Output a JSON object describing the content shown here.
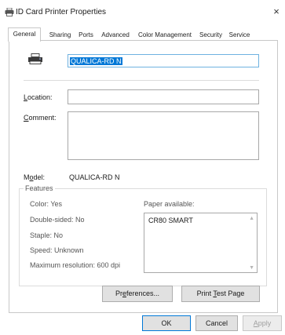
{
  "window": {
    "title": "ID Card Printer Properties",
    "close_glyph": "×",
    "icon": "printer-icon"
  },
  "tabs": [
    {
      "label": "General",
      "active": true
    },
    {
      "label": "Sharing",
      "active": false
    },
    {
      "label": "Ports",
      "active": false
    },
    {
      "label": "Advanced",
      "active": false
    },
    {
      "label": "Color Management",
      "active": false
    },
    {
      "label": "Security",
      "active": false
    },
    {
      "label": "Service",
      "active": false
    }
  ],
  "general": {
    "printer_name": "QUALICA-RD N",
    "location": {
      "label_prefix": "",
      "label_underline": "L",
      "label_rest": "ocation:",
      "value": ""
    },
    "comment": {
      "label_prefix": "",
      "label_underline": "C",
      "label_rest": "omment:",
      "value": ""
    },
    "model": {
      "label_prefix": "M",
      "label_underline": "o",
      "label_rest": "del:",
      "value": "QUALICA-RD N"
    }
  },
  "features": {
    "legend": "Features",
    "color": "Color: Yes",
    "double_sided": "Double-sided: No",
    "staple": "Staple: No",
    "speed": "Speed: Unknown",
    "max_resolution": "Maximum resolution: 600 dpi",
    "paper_label": "Paper available:",
    "paper_items": [
      "CR80 SMART"
    ]
  },
  "buttons": {
    "preferences": {
      "prefix": "Pr",
      "underline": "e",
      "rest": "ferences..."
    },
    "print_test_page": {
      "prefix": "Print ",
      "underline": "T",
      "rest": "est Page"
    },
    "ok": "OK",
    "cancel": "Cancel",
    "apply": {
      "prefix": "",
      "underline": "A",
      "rest": "pply"
    }
  },
  "colors": {
    "selection": "#0078d7",
    "focus_border": "#6fb2e0",
    "panel_border": "#c8c8c8"
  }
}
